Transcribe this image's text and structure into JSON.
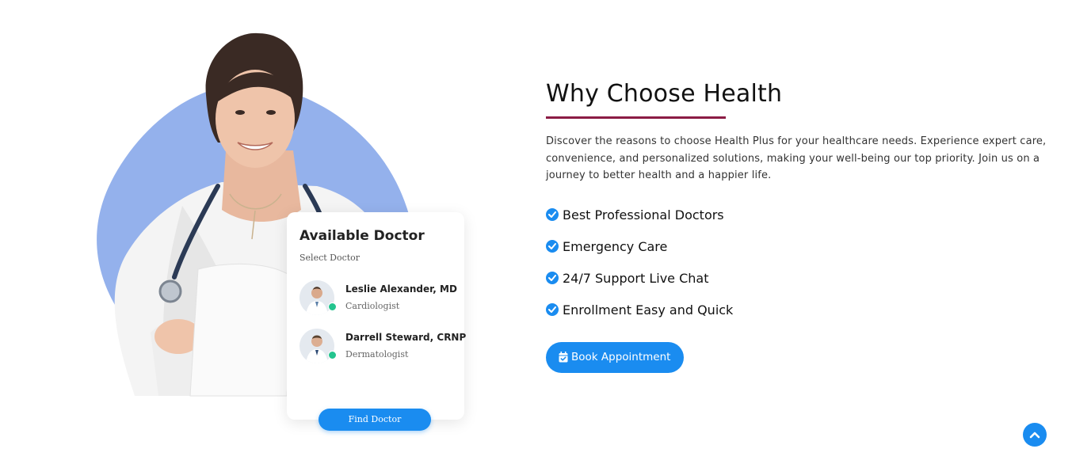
{
  "hero": {
    "image_alt": "female-doctor-with-stethoscope",
    "blob_color": "#94b1ec",
    "card": {
      "title": "Available Doctor",
      "subtitle": "Select Doctor",
      "doctors": [
        {
          "name": "Leslie Alexander, MD",
          "specialty": "Cardiologist",
          "status": "online"
        },
        {
          "name": "Darrell Steward, CRNP",
          "specialty": "Dermatologist",
          "status": "online"
        }
      ],
      "cta_label": "Find Doctor"
    }
  },
  "content": {
    "heading": "Why Choose Health",
    "accent_color": "#8b1c45",
    "lead": "Discover the reasons to choose Health Plus for your healthcare needs. Experience expert care, convenience, and personalized solutions, making your well-being our top priority. Join us on a journey to better health and a happier life.",
    "features": [
      {
        "icon": "check-circle-icon",
        "label": "Best Professional Doctors"
      },
      {
        "icon": "check-circle-icon",
        "label": "Emergency Care"
      },
      {
        "icon": "check-circle-icon",
        "label": "24/7 Support Live Chat"
      },
      {
        "icon": "check-circle-icon",
        "label": "Enrollment Easy and Quick"
      }
    ],
    "cta": {
      "icon": "calendar-check-icon",
      "label": "Book Appointment"
    },
    "brand_color": "#1a8cf0"
  },
  "scroll_top": {
    "icon": "chevron-up-icon"
  }
}
